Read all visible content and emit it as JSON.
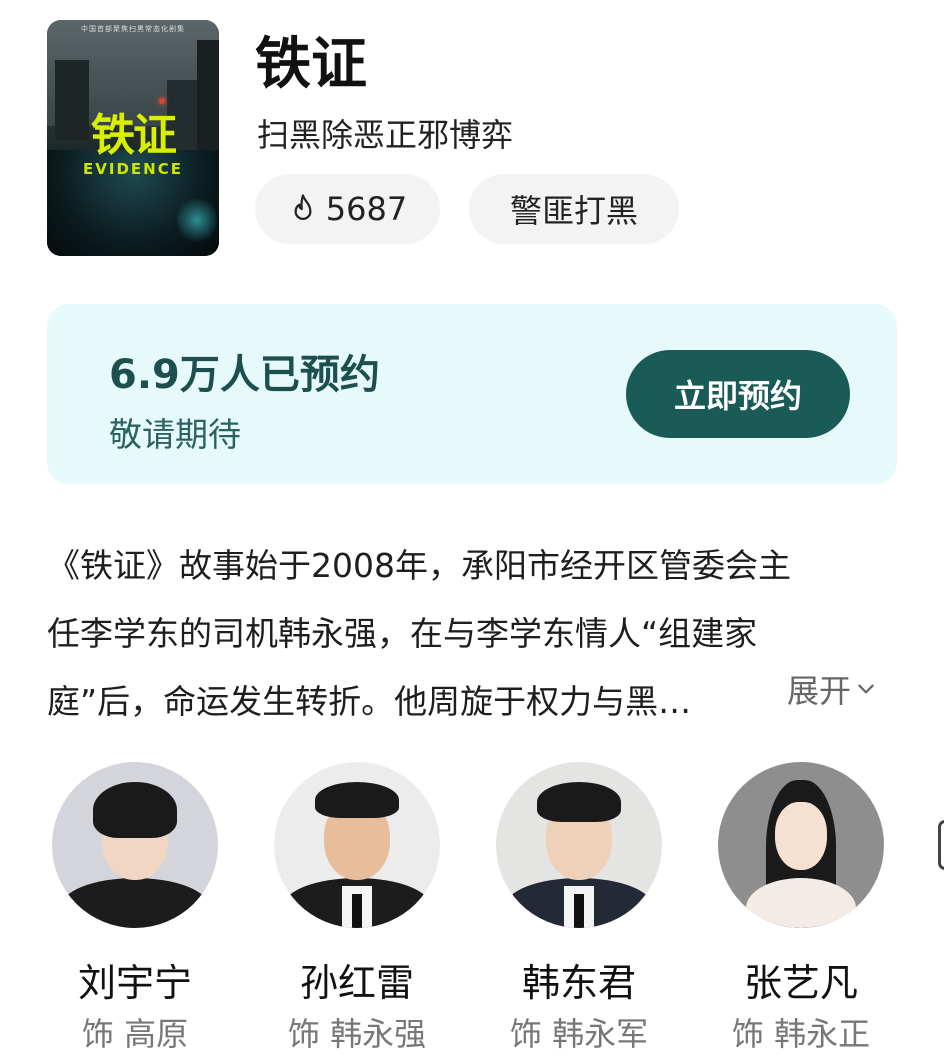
{
  "show": {
    "title": "铁证",
    "subtitle": "扫黑除恶正邪博弈",
    "heat_icon": "fire-icon",
    "heat_value": "5687",
    "genre_tag": "警匪打黑"
  },
  "poster": {
    "top_text": "中国首部聚焦扫黑常态化剧集",
    "big_title": "铁证",
    "english_title": "EVIDENCE"
  },
  "reservation": {
    "count_text": "6.9万人已预约",
    "sub_text": "敬请期待",
    "button_label": "立即预约",
    "background_color": "#e6f9fb",
    "button_color": "#1a5b57"
  },
  "synopsis": {
    "lines": [
      "《铁证》故事始于2008年，承阳市经开区管委会主",
      "任李学东的司机韩永强，在与李学东情人“组建家",
      "庭”后，命运发生转折。他周旋于权力与黑…"
    ],
    "expand_label": "展开",
    "expand_icon": "chevron-down-icon"
  },
  "cast": [
    {
      "name": "刘宇宁",
      "role": "饰 高原"
    },
    {
      "name": "孙红雷",
      "role": "饰 韩永强"
    },
    {
      "name": "韩东君",
      "role": "饰 韩永军"
    },
    {
      "name": "张艺凡",
      "role": "饰 韩永正"
    }
  ]
}
